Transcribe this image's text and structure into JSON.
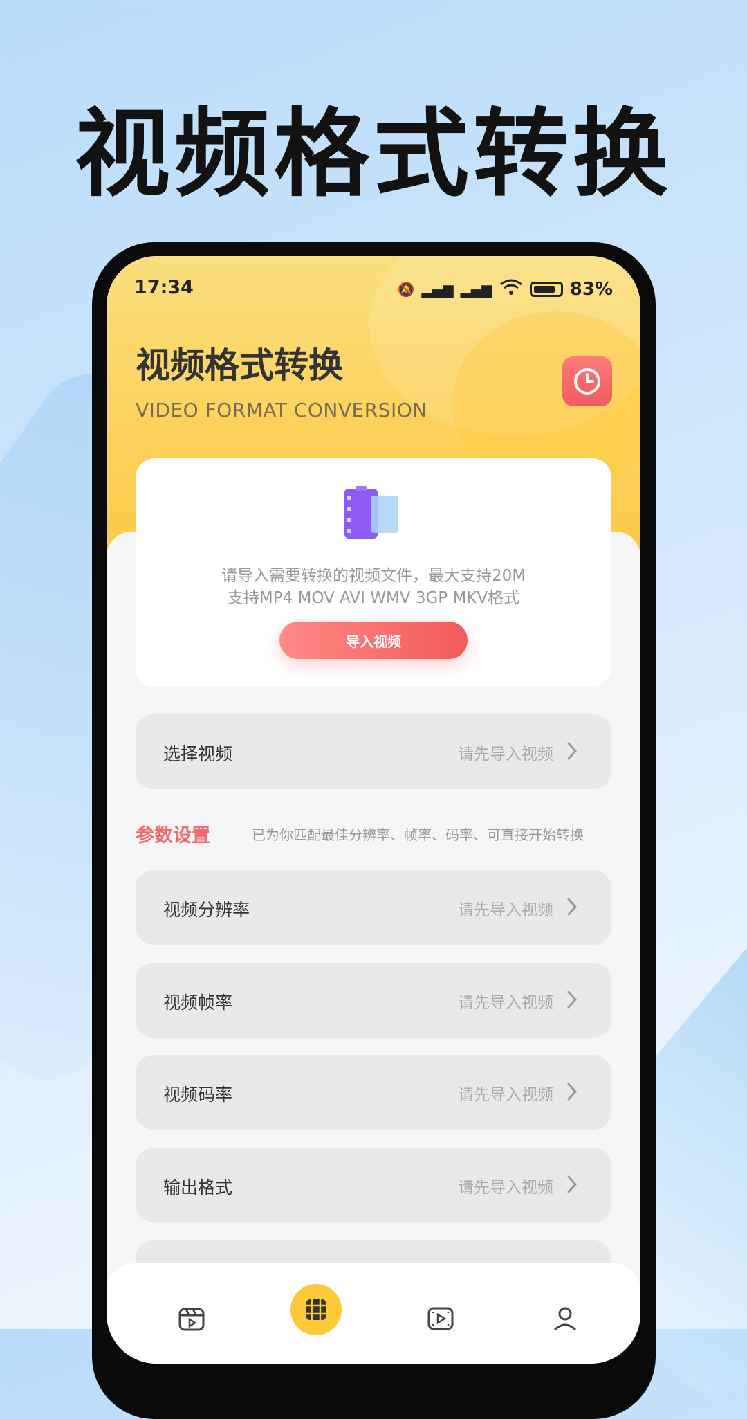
{
  "promo": {
    "title": "视频格式转换"
  },
  "status_bar": {
    "time": "17:34",
    "battery": "83%"
  },
  "header": {
    "title": "视频格式转换",
    "subtitle": "VIDEO FORMAT CONVERSION",
    "history_icon": "clock-icon"
  },
  "import_card": {
    "line1": "请导入需要转换的视频文件，最大支持20M",
    "line2": "支持MP4 MOV AVI WMV 3GP MKV格式",
    "button": "导入视频"
  },
  "select_video": {
    "label": "选择视频",
    "value": "请先导入视频"
  },
  "params": {
    "title": "参数设置",
    "note": "已为你匹配最佳分辨率、帧率、码率、可直接开始转换",
    "rows": [
      {
        "label": "视频分辨率",
        "value": "请先导入视频"
      },
      {
        "label": "视频帧率",
        "value": "请先导入视频"
      },
      {
        "label": "视频码率",
        "value": "请先导入视频"
      },
      {
        "label": "输出格式",
        "value": "请先导入视频"
      }
    ]
  },
  "tabs": [
    {
      "icon": "clapperboard-icon"
    },
    {
      "icon": "film-grid-icon",
      "active": true
    },
    {
      "icon": "video-play-icon"
    },
    {
      "icon": "user-icon"
    }
  ],
  "colors": {
    "accent": "#f25a5a",
    "header_yellow": "#fcd15a",
    "tab_active": "#fcc93a"
  }
}
